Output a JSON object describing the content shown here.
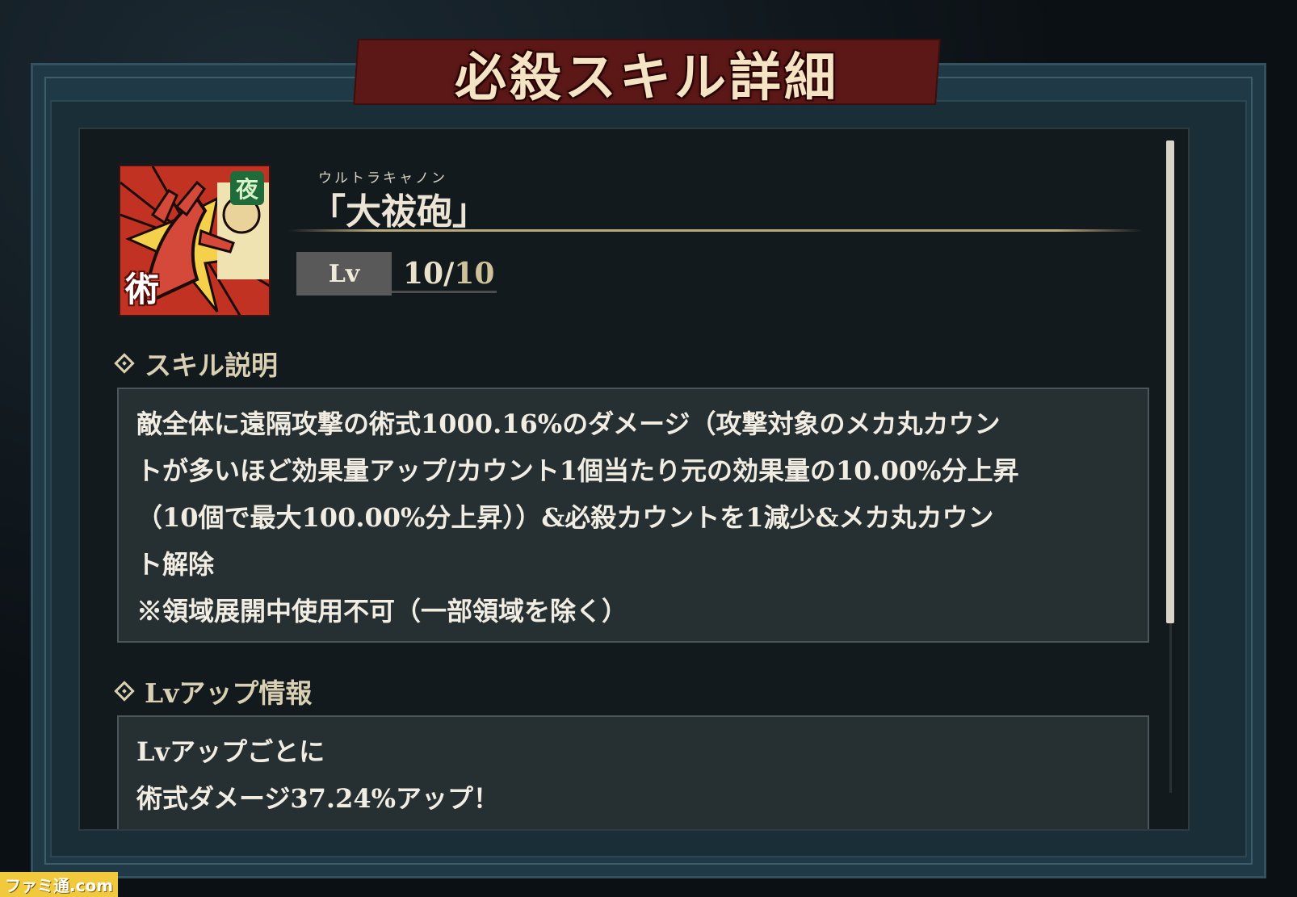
{
  "title": "必殺スキル詳細",
  "skill": {
    "icon_name": "jutsu-skill-icon",
    "icon_kanji": "術",
    "icon_badge": "夜",
    "ruby": "ウルトラキャノン",
    "name": "「大祓砲」",
    "lv_label": "Lv",
    "lv_current": "10",
    "lv_separator": "/",
    "lv_max": "10"
  },
  "sections": {
    "skill_desc": {
      "header": "スキル説明",
      "lines": [
        "敵全体に遠隔攻撃の術式1000.16%のダメージ（攻撃対象のメカ丸カウン",
        "トが多いほど効果量アップ/カウント1個当たり元の効果量の10.00%分上昇",
        "（10個で最大100.00%分上昇））&必殺カウントを1減少&メカ丸カウン",
        "ト解除",
        "※領域展開中使用不可（一部領域を除く）"
      ]
    },
    "lv_up": {
      "header": "Lvアップ情報",
      "lines": [
        "Lvアップごとに",
        "術式ダメージ37.24%アップ！"
      ]
    }
  },
  "watermark": "ファミ通.com",
  "colors": {
    "frame": "#203946",
    "panel": "#131a1d",
    "banner": "#5b1816",
    "accent_gold": "#d9cfb2"
  }
}
